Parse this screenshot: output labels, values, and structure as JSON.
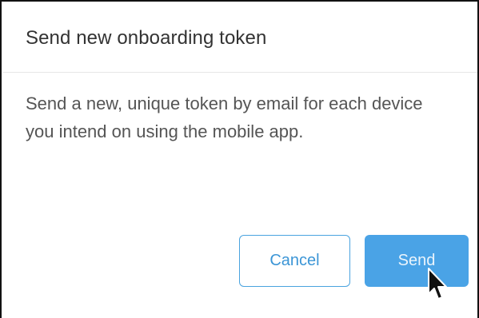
{
  "dialog": {
    "title": "Send new onboarding token",
    "message": "Send a new, unique token by email for each device you intend on using the mobile app.",
    "cancel_label": "Cancel",
    "send_label": "Send"
  },
  "colors": {
    "accent": "#4aa3e6",
    "cancel_text": "#3b95d6"
  },
  "icons": {
    "cursor": "mouse-pointer-icon"
  }
}
